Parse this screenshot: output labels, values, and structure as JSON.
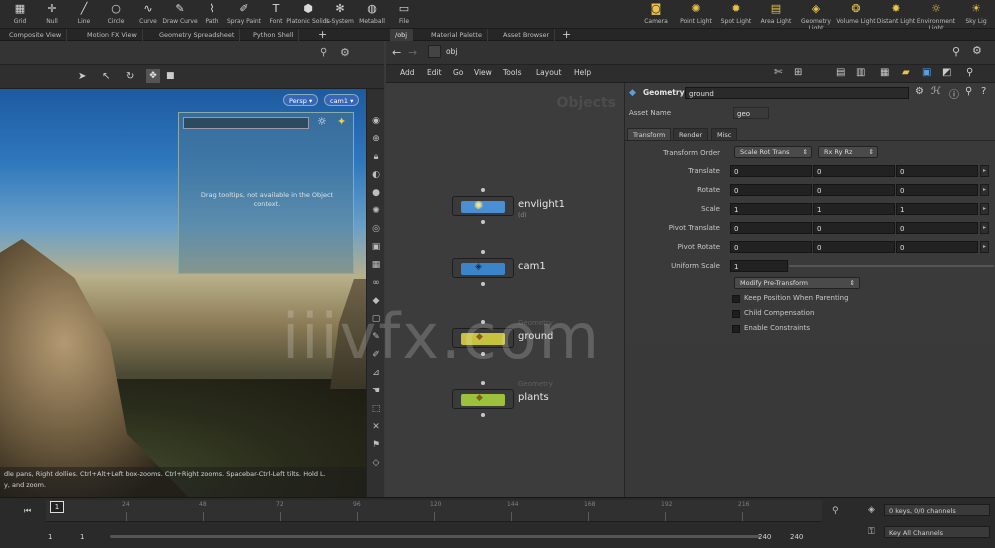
{
  "shelf": {
    "left_tools": [
      {
        "label": "Grid",
        "icon": "grid-icon"
      },
      {
        "label": "Null",
        "icon": "null-icon"
      },
      {
        "label": "Line",
        "icon": "line-icon"
      },
      {
        "label": "Circle",
        "icon": "circle-icon"
      },
      {
        "label": "Curve",
        "icon": "curve-icon"
      },
      {
        "label": "Draw Curve",
        "icon": "draw-curve-icon"
      },
      {
        "label": "Path",
        "icon": "path-icon"
      },
      {
        "label": "Spray Paint",
        "icon": "spray-paint-icon"
      },
      {
        "label": "Font",
        "icon": "font-icon"
      },
      {
        "label": "Platonic Solids",
        "icon": "platonic-icon"
      },
      {
        "label": "L-System",
        "icon": "lsystem-icon"
      },
      {
        "label": "Metaball",
        "icon": "metaball-icon"
      },
      {
        "label": "File",
        "icon": "file-icon"
      }
    ],
    "right_tools": [
      {
        "label": "Camera",
        "icon": "camera-icon"
      },
      {
        "label": "Point Light",
        "icon": "point-light-icon"
      },
      {
        "label": "Spot Light",
        "icon": "spot-light-icon"
      },
      {
        "label": "Area Light",
        "icon": "area-light-icon"
      },
      {
        "label": "Geometry Light",
        "icon": "geometry-light-icon"
      },
      {
        "label": "Volume Light",
        "icon": "volume-light-icon"
      },
      {
        "label": "Distant Light",
        "icon": "distant-light-icon"
      },
      {
        "label": "Environment Light",
        "icon": "environment-light-icon"
      },
      {
        "label": "Sky Lig",
        "icon": "sky-light-icon"
      }
    ]
  },
  "left_tabs": [
    "Composite View",
    "Motion FX View",
    "Geometry Spreadsheet",
    "Python Shell"
  ],
  "right_tabs": [
    "/obj",
    "Material Palette",
    "Asset Browser"
  ],
  "viewport": {
    "persp": "Persp",
    "cam": "cam1",
    "overlay_message": "Drag tooltips, not available in the Object context.",
    "help_text": "dle pans, Right dollies. Ctrl+Alt+Left box-zooms. Ctrl+Right zooms. Spacebar-Ctrl-Left tilts. Hold L.\ny, and zoom."
  },
  "network": {
    "path": "obj",
    "menu": [
      "Add",
      "Edit",
      "Go",
      "View",
      "Tools",
      "Layout",
      "Help"
    ],
    "context_label": "Objects",
    "nodes": [
      {
        "name": "envlight1",
        "type": "",
        "sub": "(d)",
        "color": "#4a8fd4"
      },
      {
        "name": "cam1",
        "type": "",
        "sub": "",
        "color": "#3b84c9"
      },
      {
        "name": "ground",
        "type": "Geometry",
        "sub": "",
        "color": "#c7c23d"
      },
      {
        "name": "plants",
        "type": "Geometry",
        "sub": "",
        "color": "#9cc23d"
      }
    ]
  },
  "parameters": {
    "node_type": "Geometry",
    "node_name": "ground",
    "asset_name_label": "Asset Name",
    "asset_name_value": "geo",
    "tabs": [
      "Transform",
      "Render",
      "Misc"
    ],
    "transform_order_label": "Transform Order",
    "transform_order_value": "Scale Rot Trans",
    "rotate_order_value": "Rx Ry Rz",
    "rows": [
      {
        "label": "Translate",
        "values": [
          "0",
          "0",
          "0"
        ]
      },
      {
        "label": "Rotate",
        "values": [
          "0",
          "0",
          "0"
        ]
      },
      {
        "label": "Scale",
        "values": [
          "1",
          "1",
          "1"
        ]
      },
      {
        "label": "Pivot Translate",
        "values": [
          "0",
          "0",
          "0"
        ]
      },
      {
        "label": "Pivot Rotate",
        "values": [
          "0",
          "0",
          "0"
        ]
      }
    ],
    "uniform_scale_label": "Uniform Scale",
    "uniform_scale_value": "1",
    "modify_button": "Modify Pre-Transform",
    "checkboxes": [
      "Keep Position When Parenting",
      "Child Compensation",
      "Enable Constraints"
    ]
  },
  "timeline": {
    "ticks": [
      "24",
      "48",
      "72",
      "96",
      "120",
      "144",
      "168",
      "192",
      "216"
    ],
    "current_frame": "1",
    "start_a": "1",
    "start_b": "1",
    "end_a": "240",
    "end_b": "240",
    "keys_label": "0 keys, 0/0 channels",
    "key_all_label": "Key All Channels"
  },
  "watermark": "iiivfx.com",
  "colors": {
    "accent_blue": "#3566b8",
    "light_yellow": "#e8c24a",
    "panel_dark": "#2b2b2b"
  }
}
